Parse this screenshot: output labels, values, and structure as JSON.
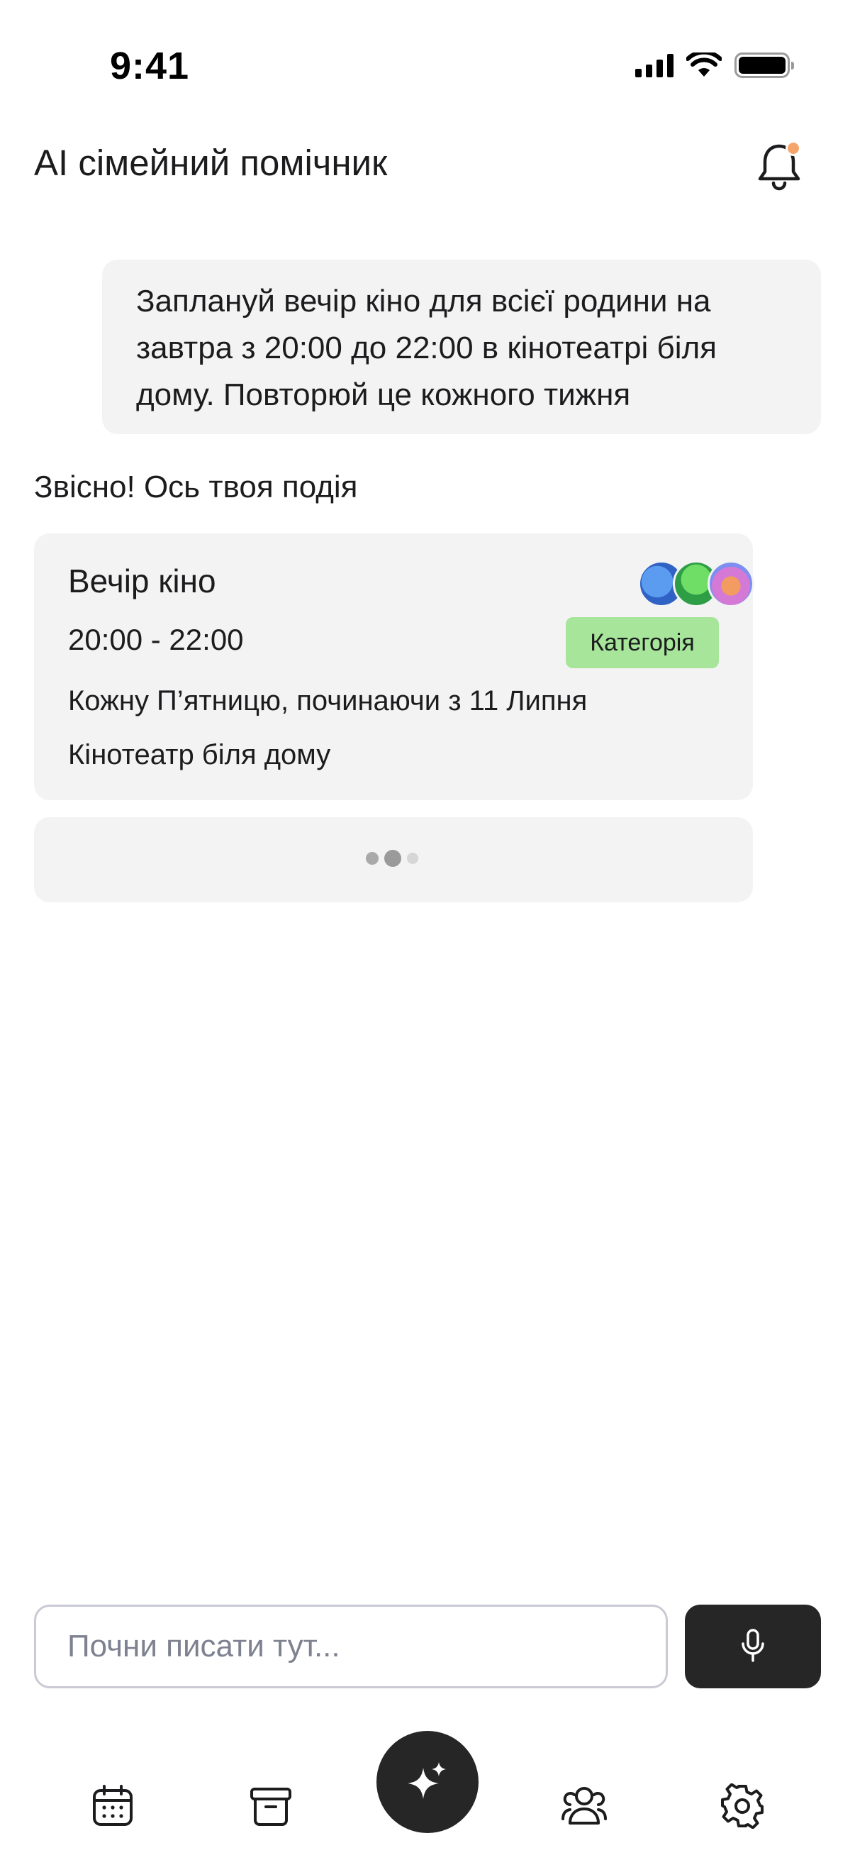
{
  "status_bar": {
    "time": "9:41"
  },
  "header": {
    "title": "AI сімейний помічник",
    "notification_dot_color": "#f5a56b"
  },
  "chat": {
    "user_message": "Заплануй вечір кіно для всієї родини на завтра з 20:00 до 22:00 в кінотеатрі біля дому. Повторюй це кожного тижня",
    "assistant_reply": "Звісно! Ось твоя подія"
  },
  "event": {
    "title": "Вечір кіно",
    "time": "20:00 - 22:00",
    "category": "Категорія",
    "category_color": "#a6e59a",
    "recurrence": "Кожну П’ятницю, починаючи з 11 Липня",
    "location": "Кінотеатр біля дому",
    "participants": [
      {
        "icon": "blue-monster-avatar-icon",
        "color": "#3f7bd9"
      },
      {
        "icon": "green-monster-avatar-icon",
        "color": "#4fc65c"
      },
      {
        "icon": "pink-monster-avatar-icon",
        "color": "#e58ac4"
      }
    ]
  },
  "input": {
    "placeholder": "Почни писати тут..."
  },
  "nav": {
    "items": [
      "calendar-icon",
      "archive-icon",
      "sparkle-icon",
      "family-icon",
      "settings-icon"
    ]
  },
  "colors": {
    "dark": "#262626",
    "bubble": "#f3f3f3"
  }
}
